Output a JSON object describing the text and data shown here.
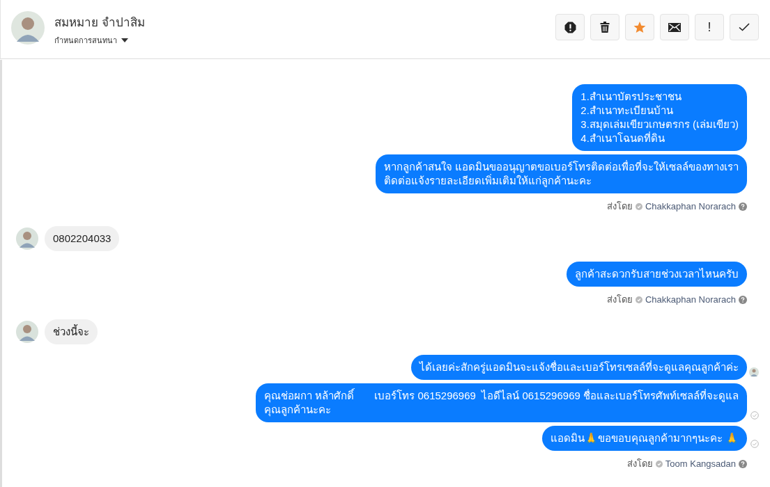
{
  "header": {
    "name": "สมหมาย จำปาสิม",
    "subtitle": "กำหนดการสนทนา"
  },
  "toolbar": [
    {
      "kind": "alert",
      "on": false
    },
    {
      "kind": "trash",
      "on": false
    },
    {
      "kind": "star",
      "on": true
    },
    {
      "kind": "mail",
      "on": false
    },
    {
      "kind": "text",
      "label": "!",
      "on": false
    },
    {
      "kind": "check",
      "on": false
    }
  ],
  "messages": [
    {
      "kind": "outgoing",
      "text": "1.สำเนาบัตรประชาชน\n2.สำเนาทะเบียนบ้าน\n3.สมุดเล่มเขียวเกษตรกร (เล่มเขียว)\n4.สำเนาโฉนดที่ดิน",
      "seen": false,
      "delivered": false
    },
    {
      "kind": "outgoing",
      "text": "หากลูกค้าสนใจ แอดมินขออนุญาตขอเบอร์โทรติดต่อเพื่อที่จะให้เซลล์ของทางเรา\nติดต่อแจ้งรายละเอียดเพิ่มเติมให้แก่ลูกค้านะคะ",
      "seen": false,
      "delivered": false
    },
    {
      "kind": "sender",
      "label": "ส่งโดย",
      "name": "Chakkaphan Norarach"
    },
    {
      "kind": "incoming",
      "text": "0802204033"
    },
    {
      "kind": "outgoing",
      "text": "ลูกค้าสะดวกรับสายช่วงเวลาไหนครับ",
      "seen": false,
      "delivered": false
    },
    {
      "kind": "sender",
      "label": "ส่งโดย",
      "name": "Chakkaphan Norarach"
    },
    {
      "kind": "incoming",
      "text": "ช่วงนี้จะ"
    },
    {
      "kind": "outgoing",
      "text": "ได้เลยค่ะสักครู่แอดมินจะแจ้งชื่อและเบอร์โทรเซลล์ที่จะดูแลคุณลูกค้าค่ะ",
      "seen": true,
      "delivered": false
    },
    {
      "kind": "outgoing",
      "text": "คุณช่อผกา หล้าศักดิ์       เบอร์โทร 0615296969  ไอดีไลน์ 0615296969 ชื่อและเบอร์โทรศัพท์เซลล์ที่จะดูแล\nคุณลูกค้านะคะ",
      "seen": false,
      "delivered": true
    },
    {
      "kind": "outgoing",
      "text": "แอดมิน🙏ขอขอบคุณลูกค้ามากๆนะคะ 🙏",
      "seen": false,
      "delivered": true
    },
    {
      "kind": "sender",
      "label": "ส่งโดย",
      "name": "Toom Kangsadan"
    }
  ]
}
